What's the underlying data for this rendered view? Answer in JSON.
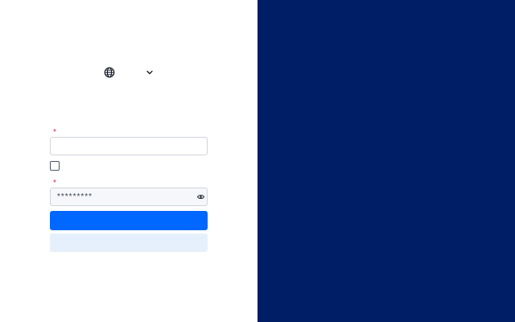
{
  "colors": {
    "panel_bg": "#001e65",
    "primary": "#0067ff",
    "secondary_bg": "#e6f0fd",
    "required": "#e11d48"
  },
  "language": {
    "icon": "globe-icon",
    "label": "",
    "chevron": "chevron-down-icon"
  },
  "form": {
    "username": {
      "label": "",
      "required_marker": "*",
      "value": "",
      "placeholder": ""
    },
    "remember": {
      "label": "",
      "checked": false
    },
    "password": {
      "label": "",
      "required_marker": "*",
      "value": "*********",
      "placeholder": "",
      "toggle_icon": "eye-icon"
    },
    "submit_label": "",
    "secondary_label": ""
  }
}
